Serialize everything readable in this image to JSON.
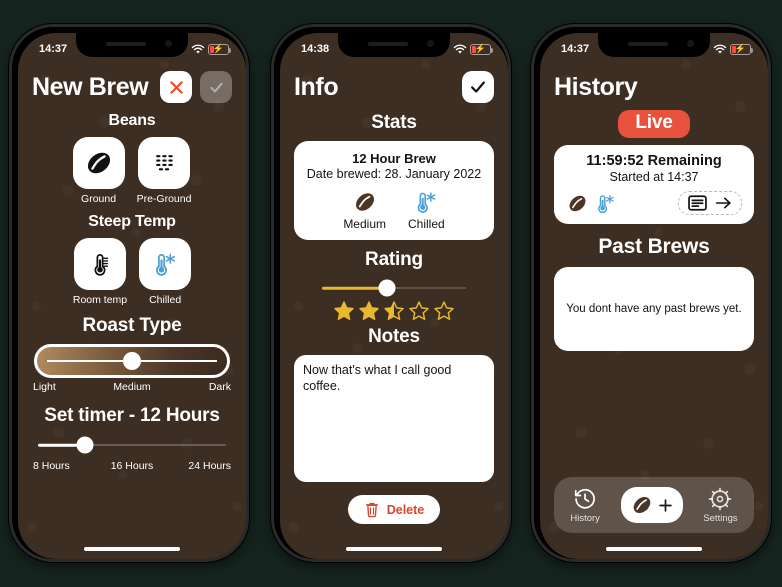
{
  "app": {
    "background_color": "#3d2e23",
    "page_background": "#16241f",
    "accent_gold": "#e8b82e",
    "accent_red": "#e8513c",
    "accent_blue": "#4a9fd8"
  },
  "phone1": {
    "status": {
      "time": "14:37",
      "wifi_icon": "wifi-icon",
      "battery_icon": "battery-charging-icon"
    },
    "nav": {
      "title": "New Brew",
      "close_icon": "close-x-icon",
      "confirm_icon": "checkmark-icon"
    },
    "beans": {
      "title": "Beans",
      "options": [
        {
          "label": "Ground",
          "icon": "coffee-bean-icon",
          "selected": true
        },
        {
          "label": "Pre-Ground",
          "icon": "coffee-grounds-icon",
          "selected": false
        }
      ]
    },
    "steep_temp": {
      "title": "Steep Temp",
      "options": [
        {
          "label": "Room temp",
          "icon": "thermometer-icon",
          "selected": false
        },
        {
          "label": "Chilled",
          "icon": "thermometer-snowflake-icon",
          "selected": true
        }
      ]
    },
    "roast": {
      "title": "Roast Type",
      "labels": [
        "Light",
        "Medium",
        "Dark"
      ],
      "value_percent": 50
    },
    "timer": {
      "title": "Set timer - 12 Hours",
      "labels": [
        "8 Hours",
        "16 Hours",
        "24 Hours"
      ],
      "value_percent": 25
    }
  },
  "phone2": {
    "status": {
      "time": "14:38",
      "wifi_icon": "wifi-icon",
      "battery_icon": "battery-charging-icon"
    },
    "nav": {
      "title": "Info",
      "confirm_icon": "checkmark-icon"
    },
    "stats": {
      "title": "Stats",
      "brew_name": "12 Hour Brew",
      "date_line": "Date brewed: 28. January 2022",
      "attributes": [
        {
          "label": "Medium",
          "icon": "coffee-bean-icon"
        },
        {
          "label": "Chilled",
          "icon": "thermometer-snowflake-icon"
        }
      ]
    },
    "rating": {
      "title": "Rating",
      "value": 2.5,
      "max": 5,
      "slider_percent": 45
    },
    "notes": {
      "title": "Notes",
      "text": "Now that's what I call good coffee."
    },
    "delete": {
      "label": "Delete",
      "icon": "trash-icon"
    }
  },
  "phone3": {
    "status": {
      "time": "14:37",
      "wifi_icon": "wifi-icon",
      "battery_icon": "battery-charging-icon"
    },
    "nav": {
      "title": "History"
    },
    "live": {
      "badge": "Live"
    },
    "active_brew": {
      "remaining": "11:59:52 Remaining",
      "started": "Started at 14:37",
      "icons": [
        "coffee-bean-icon",
        "thermometer-snowflake-icon"
      ],
      "open_icon": "notes-card-icon",
      "arrow_icon": "arrow-right-icon"
    },
    "past": {
      "title": "Past Brews",
      "empty_text": "You dont have any past brews yet."
    },
    "tabbar": {
      "items": [
        {
          "label": "History",
          "icon": "clock-history-icon",
          "active": true
        },
        {
          "label": "",
          "icon": "coffee-bean-plus-icon",
          "active": false
        },
        {
          "label": "Settings",
          "icon": "gear-icon",
          "active": false
        }
      ]
    }
  }
}
